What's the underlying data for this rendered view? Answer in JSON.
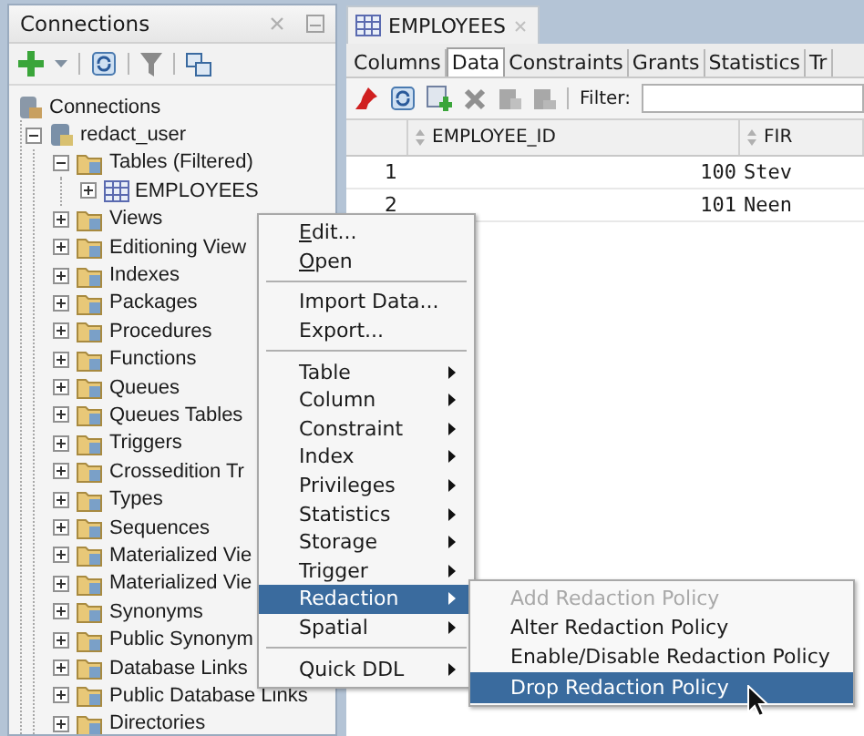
{
  "connections_panel": {
    "title": "Connections",
    "tree": [
      {
        "label": "Connections",
        "kind": "connections",
        "children": [
          {
            "label": "redact_user",
            "kind": "connection",
            "expanded": true,
            "children": [
              {
                "label": "Tables (Filtered)",
                "kind": "folder",
                "expanded": true,
                "children": [
                  {
                    "label": "EMPLOYEES",
                    "kind": "table",
                    "expanded": false
                  }
                ]
              },
              {
                "label": "Views",
                "kind": "folder",
                "expanded": false
              },
              {
                "label": "Editioning View",
                "kind": "folder",
                "expanded": false
              },
              {
                "label": "Indexes",
                "kind": "folder",
                "expanded": false
              },
              {
                "label": "Packages",
                "kind": "folder",
                "expanded": false
              },
              {
                "label": "Procedures",
                "kind": "folder",
                "expanded": false
              },
              {
                "label": "Functions",
                "kind": "folder",
                "expanded": false
              },
              {
                "label": "Queues",
                "kind": "folder",
                "expanded": false
              },
              {
                "label": "Queues Tables",
                "kind": "folder",
                "expanded": false
              },
              {
                "label": "Triggers",
                "kind": "folder",
                "expanded": false
              },
              {
                "label": "Crossedition Tr",
                "kind": "folder",
                "expanded": false
              },
              {
                "label": "Types",
                "kind": "folder",
                "expanded": false
              },
              {
                "label": "Sequences",
                "kind": "folder",
                "expanded": false
              },
              {
                "label": "Materialized Vie",
                "kind": "folder",
                "expanded": false
              },
              {
                "label": "Materialized Vie",
                "kind": "folder",
                "expanded": false
              },
              {
                "label": "Synonyms",
                "kind": "folder",
                "expanded": false
              },
              {
                "label": "Public Synonym",
                "kind": "folder",
                "expanded": false
              },
              {
                "label": "Database Links",
                "kind": "folder",
                "expanded": false
              },
              {
                "label": "Public Database Links",
                "kind": "folder",
                "expanded": false
              },
              {
                "label": "Directories",
                "kind": "folder",
                "expanded": false
              }
            ]
          }
        ]
      }
    ]
  },
  "editor": {
    "tab": "EMPLOYEES",
    "subtabs": [
      {
        "label": "Columns",
        "selected": false
      },
      {
        "label": "Data",
        "selected": true
      },
      {
        "label": "Constraints",
        "selected": false
      },
      {
        "label": "Grants",
        "selected": false
      },
      {
        "label": "Statistics",
        "selected": false
      },
      {
        "label": "Tr",
        "selected": false
      }
    ],
    "filter_label": "Filter:",
    "table": {
      "columns": [
        "EMPLOYEE_ID",
        "FIR"
      ],
      "rows": [
        {
          "number": "1",
          "cells": [
            "100",
            "Stev"
          ]
        },
        {
          "number": "2",
          "cells": [
            "101",
            "Neen"
          ]
        }
      ]
    }
  },
  "context_menu": [
    {
      "kind": "item",
      "label": "Edit...",
      "mnemonic": true,
      "submenu": false,
      "selected": false
    },
    {
      "kind": "item",
      "label": "Open",
      "mnemonic": true,
      "submenu": false,
      "selected": false
    },
    {
      "kind": "separator"
    },
    {
      "kind": "item",
      "label": "Import Data...",
      "mnemonic": false,
      "submenu": false,
      "selected": false
    },
    {
      "kind": "item",
      "label": "Export...",
      "mnemonic": false,
      "submenu": false,
      "selected": false
    },
    {
      "kind": "separator"
    },
    {
      "kind": "item",
      "label": "Table",
      "mnemonic": false,
      "submenu": true,
      "selected": false
    },
    {
      "kind": "item",
      "label": "Column",
      "mnemonic": false,
      "submenu": true,
      "selected": false
    },
    {
      "kind": "item",
      "label": "Constraint",
      "mnemonic": false,
      "submenu": true,
      "selected": false
    },
    {
      "kind": "item",
      "label": "Index",
      "mnemonic": false,
      "submenu": true,
      "selected": false
    },
    {
      "kind": "item",
      "label": "Privileges",
      "mnemonic": false,
      "submenu": true,
      "selected": false
    },
    {
      "kind": "item",
      "label": "Statistics",
      "mnemonic": false,
      "submenu": true,
      "selected": false
    },
    {
      "kind": "item",
      "label": "Storage",
      "mnemonic": false,
      "submenu": true,
      "selected": false
    },
    {
      "kind": "item",
      "label": "Trigger",
      "mnemonic": false,
      "submenu": true,
      "selected": false
    },
    {
      "kind": "item",
      "label": "Redaction",
      "mnemonic": false,
      "submenu": true,
      "selected": true
    },
    {
      "kind": "item",
      "label": "Spatial",
      "mnemonic": false,
      "submenu": true,
      "selected": false
    },
    {
      "kind": "separator"
    },
    {
      "kind": "item",
      "label": "Quick DDL",
      "mnemonic": false,
      "submenu": true,
      "selected": false
    }
  ],
  "submenu": [
    {
      "label": "Add Redaction Policy",
      "disabled": true,
      "selected": false
    },
    {
      "label": "Alter Redaction Policy",
      "disabled": false,
      "selected": false
    },
    {
      "label": "Enable/Disable Redaction Policy",
      "disabled": false,
      "selected": false
    },
    {
      "label": "Drop Redaction Policy",
      "disabled": false,
      "selected": true
    }
  ]
}
